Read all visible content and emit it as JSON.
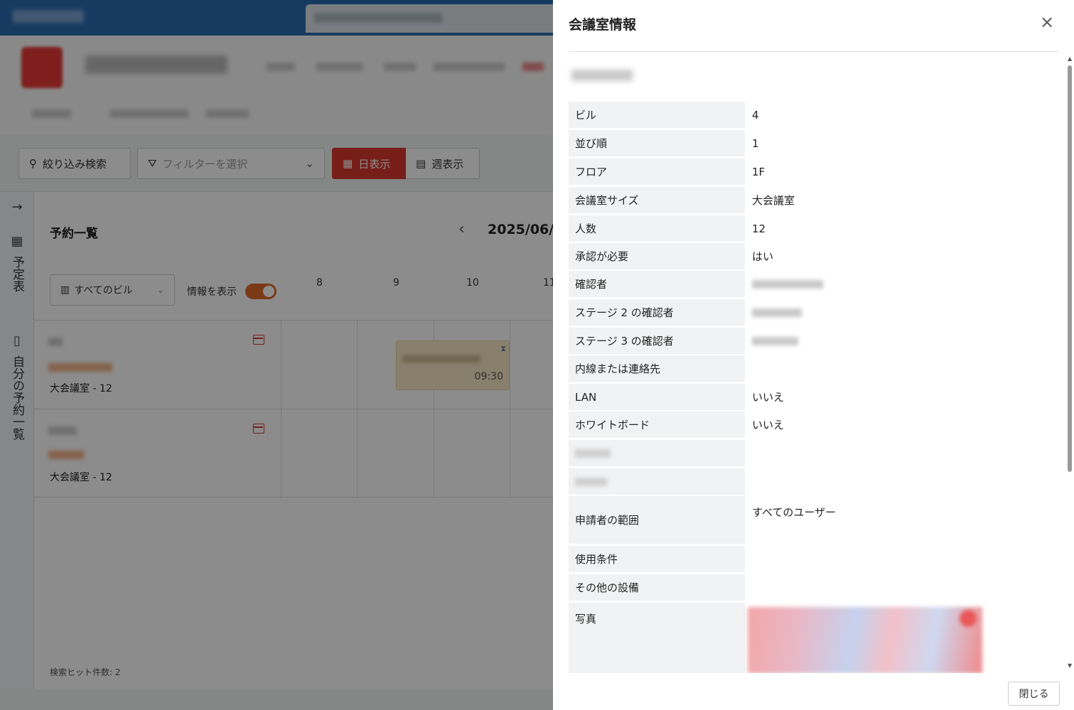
{
  "app": {
    "toolbar": {
      "search_label": "絞り込み検索",
      "filter_placeholder": "フィルターを選択",
      "day_view_label": "日表示",
      "week_view_label": "週表示"
    },
    "sidenav": {
      "schedule_label": "予定表",
      "my_reservations_label": "自分の予約一覧"
    },
    "main": {
      "title": "予約一覧",
      "date": "2025/06/",
      "building_select": "すべてのビル",
      "show_info_label": "情報を表示",
      "show_info_on": true,
      "hours": [
        "8",
        "9",
        "10",
        "11"
      ],
      "rooms": [
        {
          "size_label": "大会議室 - 12"
        },
        {
          "size_label": "大会議室 - 12"
        }
      ],
      "event_time": "09:30",
      "hit_count": "検索ヒット件数: 2"
    }
  },
  "drawer": {
    "title": "会議室情報",
    "close_button": "閉じる",
    "rows": [
      {
        "label": "ビル",
        "value": "4"
      },
      {
        "label": "並び順",
        "value": "1"
      },
      {
        "label": "フロア",
        "value": "1F"
      },
      {
        "label": "会議室サイズ",
        "value": "大会議室"
      },
      {
        "label": "人数",
        "value": "12"
      },
      {
        "label": "承認が必要",
        "value": "はい"
      },
      {
        "label": "確認者",
        "value": ""
      },
      {
        "label": "ステージ 2 の確認者",
        "value": ""
      },
      {
        "label": "ステージ 3 の確認者",
        "value": ""
      },
      {
        "label": "内線または連絡先",
        "value": ""
      },
      {
        "label": "LAN",
        "value": "いいえ"
      },
      {
        "label": "ホワイトボード",
        "value": "いいえ"
      },
      {
        "label": "",
        "value": ""
      },
      {
        "label": "",
        "value": ""
      },
      {
        "label": "申請者の範囲",
        "value": "すべてのユーザー"
      },
      {
        "label": "使用条件",
        "value": ""
      },
      {
        "label": "その他の設備",
        "value": ""
      },
      {
        "label": "写真",
        "value": ""
      }
    ]
  },
  "colors": {
    "accent_red": "#d9382c",
    "toggle_orange": "#e06b2a",
    "label_bg": "#f1f2f3",
    "event_bg": "#f7e9c6"
  }
}
